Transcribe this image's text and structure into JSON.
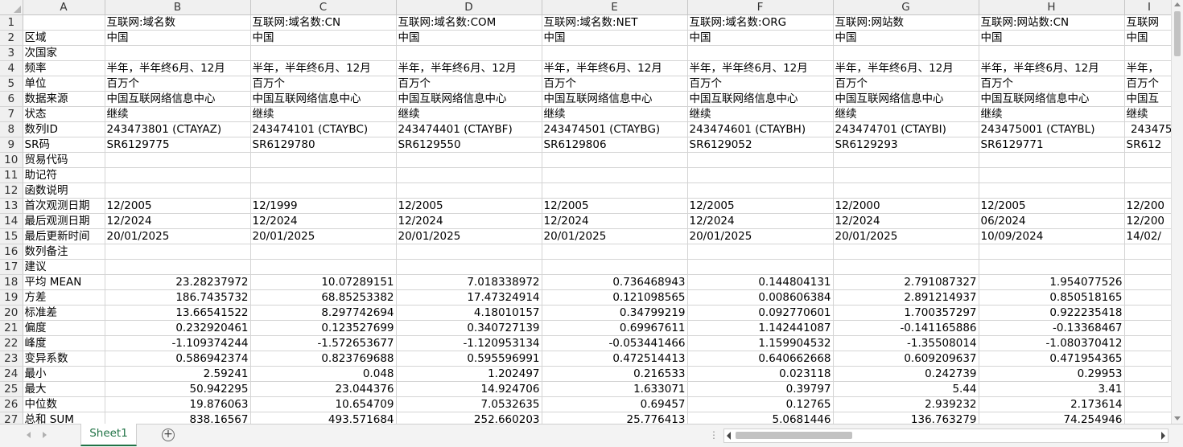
{
  "columns": [
    "A",
    "B",
    "C",
    "D",
    "E",
    "F",
    "G",
    "H",
    "I"
  ],
  "rows": [
    {
      "n": "1",
      "cells": [
        "",
        "互联网:域名数",
        "互联网:域名数:CN",
        "互联网:域名数:COM",
        "互联网:域名数:NET",
        "互联网:域名数:ORG",
        "互联网:网站数",
        "互联网:网站数:CN",
        "互联网"
      ]
    },
    {
      "n": "2",
      "cells": [
        "区域",
        "中国",
        "中国",
        "中国",
        "中国",
        "中国",
        "中国",
        "中国",
        "中国"
      ]
    },
    {
      "n": "3",
      "cells": [
        "次国家",
        "",
        "",
        "",
        "",
        "",
        "",
        "",
        ""
      ]
    },
    {
      "n": "4",
      "cells": [
        "频率",
        "半年，半年终6月、12月",
        "半年，半年终6月、12月",
        "半年，半年终6月、12月",
        "半年，半年终6月、12月",
        "半年，半年终6月、12月",
        "半年，半年终6月、12月",
        "半年，半年终6月、12月",
        "半年，"
      ]
    },
    {
      "n": "5",
      "cells": [
        "单位",
        "百万个",
        "百万个",
        "百万个",
        "百万个",
        "百万个",
        "百万个",
        "百万个",
        "百万个"
      ]
    },
    {
      "n": "6",
      "cells": [
        "数据来源",
        "中国互联网络信息中心",
        "中国互联网络信息中心",
        "中国互联网络信息中心",
        "中国互联网络信息中心",
        "中国互联网络信息中心",
        "中国互联网络信息中心",
        "中国互联网络信息中心",
        "中国互"
      ]
    },
    {
      "n": "7",
      "cells": [
        "状态",
        "继续",
        "继续",
        "继续",
        "继续",
        "继续",
        "继续",
        "继续",
        "继续"
      ]
    },
    {
      "n": "8",
      "cells": [
        "数列ID",
        "243473801 (CTAYAZ)",
        "243474101 (CTAYBC)",
        "243474401 (CTAYBF)",
        "243474501 (CTAYBG)",
        "243474601 (CTAYBH)",
        "243474701 (CTAYBI)",
        "243475001 (CTAYBL)",
        "243475"
      ]
    },
    {
      "n": "9",
      "cells": [
        "SR码",
        "SR6129775",
        "SR6129780",
        "SR6129550",
        "SR6129806",
        "SR6129052",
        "SR6129293",
        "SR6129771",
        "SR612"
      ]
    },
    {
      "n": "10",
      "cells": [
        "贸易代码",
        "",
        "",
        "",
        "",
        "",
        "",
        "",
        ""
      ]
    },
    {
      "n": "11",
      "cells": [
        "助记符",
        "",
        "",
        "",
        "",
        "",
        "",
        "",
        ""
      ]
    },
    {
      "n": "12",
      "cells": [
        "函数说明",
        "",
        "",
        "",
        "",
        "",
        "",
        "",
        ""
      ]
    },
    {
      "n": "13",
      "cells": [
        "首次观测日期",
        "12/2005",
        "12/1999",
        "12/2005",
        "12/2005",
        "12/2005",
        "12/2000",
        "12/2005",
        "12/200"
      ]
    },
    {
      "n": "14",
      "cells": [
        "最后观测日期",
        "12/2024",
        "12/2024",
        "12/2024",
        "12/2024",
        "12/2024",
        "12/2024",
        "06/2024",
        "12/200"
      ]
    },
    {
      "n": "15",
      "cells": [
        "最后更新时间",
        "20/01/2025",
        "20/01/2025",
        "20/01/2025",
        "20/01/2025",
        "20/01/2025",
        "20/01/2025",
        "10/09/2024",
        "14/02/"
      ]
    },
    {
      "n": "16",
      "cells": [
        "数列备注",
        "",
        "",
        "",
        "",
        "",
        "",
        "",
        ""
      ]
    },
    {
      "n": "17",
      "cells": [
        "建议",
        "",
        "",
        "",
        "",
        "",
        "",
        "",
        ""
      ]
    },
    {
      "n": "18",
      "cells": [
        "平均 MEAN",
        "23.28237972",
        "10.07289151",
        "7.018338972",
        "0.736468943",
        "0.144804131",
        "2.791087327",
        "1.954077526",
        ""
      ]
    },
    {
      "n": "19",
      "cells": [
        "方差",
        "186.7435732",
        "68.85253382",
        "17.47324914",
        "0.121098565",
        "0.008606384",
        "2.891214937",
        "0.850518165",
        ""
      ]
    },
    {
      "n": "20",
      "cells": [
        "标准差",
        "13.66541522",
        "8.297742694",
        "4.18010157",
        "0.34799219",
        "0.092770601",
        "1.700357297",
        "0.922235418",
        ""
      ]
    },
    {
      "n": "21",
      "cells": [
        "偏度",
        "0.232920461",
        "0.123527699",
        "0.340727139",
        "0.69967611",
        "1.142441087",
        "-0.141165886",
        "-0.13368467",
        ""
      ]
    },
    {
      "n": "22",
      "cells": [
        "峰度",
        "-1.109374244",
        "-1.572653677",
        "-1.120953134",
        "-0.053441466",
        "1.159904532",
        "-1.35508014",
        "-1.080370412",
        ""
      ]
    },
    {
      "n": "23",
      "cells": [
        "变异系数",
        "0.586942374",
        "0.823769688",
        "0.595596991",
        "0.472514413",
        "0.640662668",
        "0.609209637",
        "0.471954365",
        ""
      ]
    },
    {
      "n": "24",
      "cells": [
        "最小",
        "2.59241",
        "0.048",
        "1.202497",
        "0.216533",
        "0.023118",
        "0.242739",
        "0.29953",
        ""
      ]
    },
    {
      "n": "25",
      "cells": [
        "最大",
        "50.942295",
        "23.044376",
        "14.924706",
        "1.633071",
        "0.39797",
        "5.44",
        "3.41",
        ""
      ]
    },
    {
      "n": "26",
      "cells": [
        "中位数",
        "19.876063",
        "10.654709",
        "7.0532635",
        "0.69457",
        "0.12765",
        "2.939232",
        "2.173614",
        ""
      ]
    },
    {
      "n": "27",
      "cells": [
        "总和 SUM",
        "838.16567",
        "493.571684",
        "252.660203",
        "25.776413",
        "5.0681446",
        "136.763279",
        "74.254946",
        ""
      ]
    }
  ],
  "sheet_tab": "Sheet1",
  "add_sheet_label": "+",
  "tab_separator": "⋮"
}
